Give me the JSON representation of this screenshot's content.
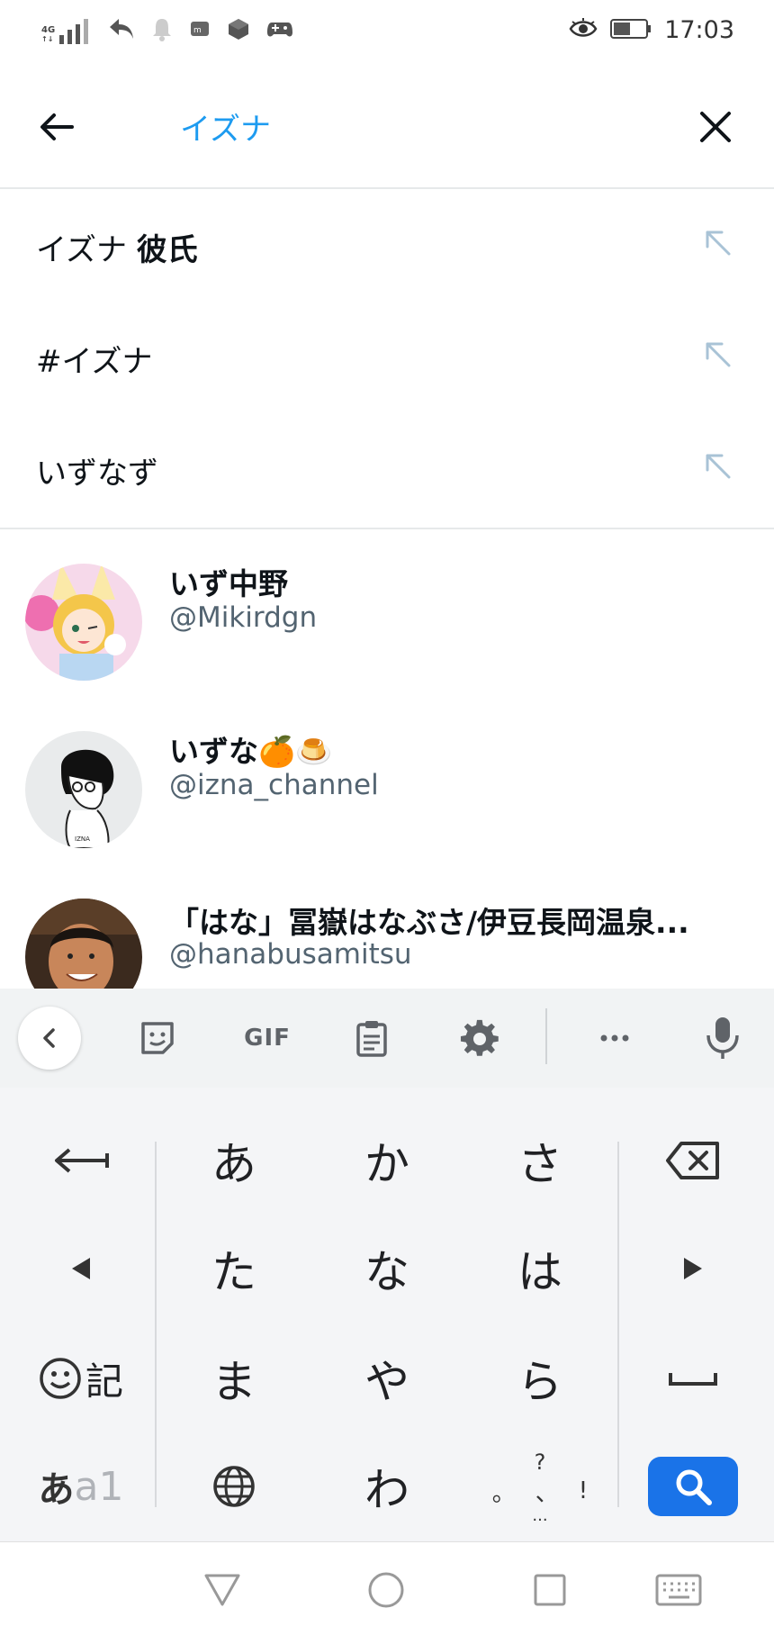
{
  "status_bar": {
    "network": "4G",
    "time": "17:03"
  },
  "search": {
    "query": "イズナ",
    "placeholder": ""
  },
  "suggestions": [
    {
      "prefix": "イズナ ",
      "bold": "彼氏"
    },
    {
      "prefix": "#イズナ",
      "bold": ""
    },
    {
      "prefix": "いずなず",
      "bold": ""
    }
  ],
  "users": [
    {
      "name": "いず中野",
      "handle": "@Mikirdgn"
    },
    {
      "name": "いずな🍊🍮",
      "handle": "@izna_channel"
    },
    {
      "name": "「はな」冨嶽はなぶさ/伊豆長岡温泉...",
      "handle": "@hanabusamitsu"
    }
  ],
  "keyboard": {
    "toolbar": {
      "gif_label": "GIF"
    },
    "kana_rows": [
      [
        "あ",
        "か",
        "さ"
      ],
      [
        "た",
        "な",
        "は"
      ],
      [
        "ま",
        "や",
        "ら"
      ],
      [
        "",
        "わ",
        ""
      ]
    ],
    "symbol_key": "記",
    "mode_key_a": "あ",
    "mode_key_b": "a1",
    "punct_key": {
      "top": "?",
      "mid_left": "。",
      "mid_center": "、",
      "mid_right": "!",
      "bottom": "..."
    }
  },
  "colors": {
    "accent": "#1d9bf0",
    "search_key": "#1a73e8",
    "handle": "#536471"
  }
}
